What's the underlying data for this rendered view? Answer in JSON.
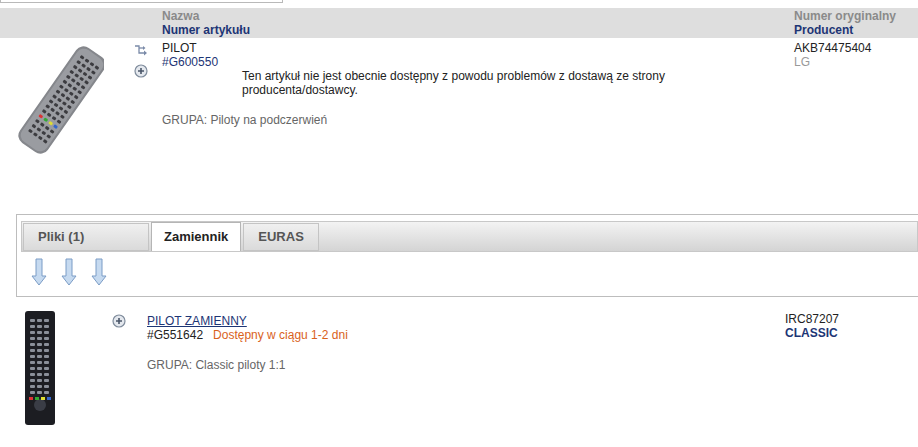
{
  "header": {
    "name_label": "Nazwa",
    "number_label": "Numer artykułu",
    "original_label": "Numer oryginalny",
    "producer_label": "Producent"
  },
  "item": {
    "name": "PILOT",
    "number": "#G600550",
    "notice": "Ten artykuł nie jest obecnie dostępny z powodu problemów z dostawą ze strony producenta/dostawcy.",
    "group": "GRUPA: Piloty na podczerwień",
    "original_number": "AKB74475404",
    "producer": "LG"
  },
  "tabs": [
    {
      "label": "Pliki (1)",
      "selected": false
    },
    {
      "label": "Zamiennik",
      "selected": true
    },
    {
      "label": "EURAS",
      "selected": false
    }
  ],
  "replacements": [
    {
      "name": "PILOT ZAMIENNY",
      "number": "#G551642",
      "availability": "Dostępny w ciągu 1-2 dni",
      "group": "GRUPA: Classic piloty 1:1",
      "original_number": "IRC87207",
      "producer": "CLASSIC"
    }
  ]
}
